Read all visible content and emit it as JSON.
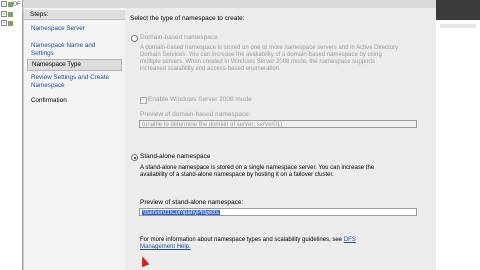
{
  "window": {
    "tree_label": "DF"
  },
  "wizard": {
    "steps_title": "Steps:",
    "steps": [
      {
        "label": "Namespace Server",
        "state": "link"
      },
      {
        "label": "Namespace Name and Settings",
        "state": "link"
      },
      {
        "label": "Namespace Type",
        "state": "active"
      },
      {
        "label": "Review Settings and Create Namespace",
        "state": "link"
      },
      {
        "label": "Confirmation",
        "state": "plain"
      }
    ]
  },
  "main": {
    "prompt": "Select the type of namespace to create:",
    "domain_option": {
      "label": "Domain-based namespace",
      "description_lines": [
        "A domain-based namespace is stored on one or more namespace servers and in Active Directory",
        "Domain Services. You can increase the availability of a domain-based namespace by using",
        "multiple servers. When created in Windows Server 2008 mode, the namespace supports",
        "increased scalability and access-based enumeration."
      ],
      "checkbox_label": "Enable Windows Server 2008 mode",
      "preview_label": "Preview of domain-based namespace:",
      "preview_value": "(unable to determine the domain of server: server01)",
      "selected": false
    },
    "standalone_option": {
      "label": "Stand-alone namespace",
      "description_lines": [
        "A stand-alone namespace is stored on a single namespace server. You can increase the",
        "availability of a stand-alone namespace by hosting it on a failover cluster."
      ],
      "preview_label": "Preview of stand-alone namespace:",
      "preview_value": "\\\\server01\\CompanyProjects",
      "selected": true
    },
    "more_info_text": "For more information about namespace types and scalability guidelines, see",
    "more_info_link_1": "DFS",
    "more_info_link_2": "Management Help."
  },
  "colors": {
    "link": "#1f4f9a",
    "selection": "#3367d6",
    "cursor": "#d62020"
  }
}
